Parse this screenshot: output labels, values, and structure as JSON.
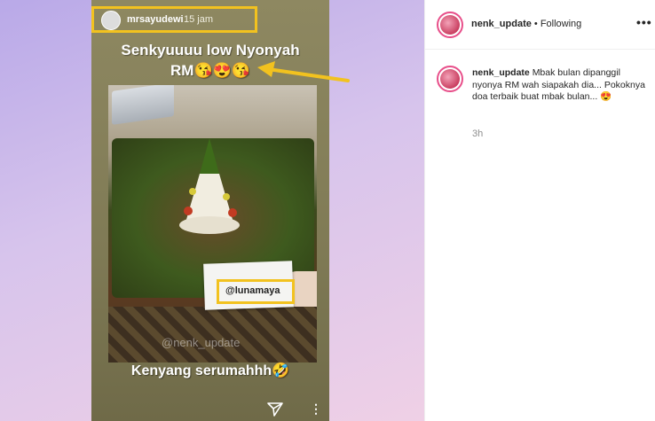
{
  "story": {
    "username": "mrsayudewi",
    "time": "15 jam",
    "caption_line1": "Senkyuuuu low Nyonyah",
    "caption_line2": "RM😘😍😘",
    "mention": "@lunamaya",
    "watermark": "@nenk_update",
    "caption_bottom": "Kenyang serumahhh🤣"
  },
  "post": {
    "header_username": "nenk_update",
    "follow_status": "• Following",
    "comment_username": "nenk_update",
    "comment_text": "Mbak bulan dipanggil nyonya RM wah siapakah dia... Pokoknya doa terbaik buat mbak bulan... 😍",
    "comment_time": "3h"
  },
  "colors": {
    "highlight": "#f2c21f",
    "avatar_ring": "#e84f8a"
  },
  "icons": {
    "send": "send-icon",
    "more_story": "more-vertical-icon",
    "more_post": "more-horizontal-icon"
  }
}
